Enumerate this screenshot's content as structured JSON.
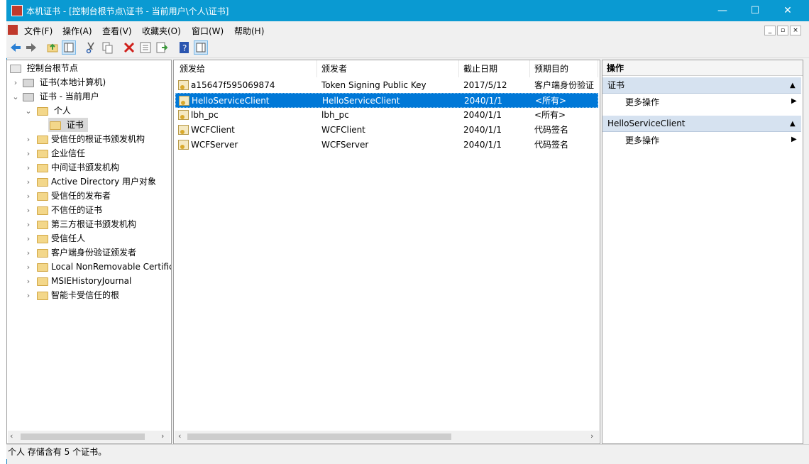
{
  "window": {
    "title": "本机证书 - [控制台根节点\\证书 - 当前用户\\个人\\证书]",
    "minimize": "—",
    "maximize": "☐",
    "close": "✕"
  },
  "menu": [
    "文件(F)",
    "操作(A)",
    "查看(V)",
    "收藏夹(O)",
    "窗口(W)",
    "帮助(H)"
  ],
  "tree": {
    "root": "控制台根节点",
    "items": [
      {
        "label": "证书(本地计算机)",
        "icon": "cert-store-icon"
      },
      {
        "label": "证书 - 当前用户",
        "icon": "cert-store-icon"
      },
      {
        "label": "个人",
        "icon": "folder-icon"
      },
      {
        "label": "证书",
        "icon": "folder-icon"
      },
      {
        "label": "受信任的根证书颁发机构",
        "icon": "folder-icon"
      },
      {
        "label": "企业信任",
        "icon": "folder-icon"
      },
      {
        "label": "中间证书颁发机构",
        "icon": "folder-icon"
      },
      {
        "label": "Active Directory 用户对象",
        "icon": "folder-icon"
      },
      {
        "label": "受信任的发布者",
        "icon": "folder-icon"
      },
      {
        "label": "不信任的证书",
        "icon": "folder-icon"
      },
      {
        "label": "第三方根证书颁发机构",
        "icon": "folder-icon"
      },
      {
        "label": "受信任人",
        "icon": "folder-icon"
      },
      {
        "label": "客户端身份验证颁发者",
        "icon": "folder-icon"
      },
      {
        "label": "Local NonRemovable Certific",
        "icon": "folder-icon"
      },
      {
        "label": "MSIEHistoryJournal",
        "icon": "folder-icon"
      },
      {
        "label": "智能卡受信任的根",
        "icon": "folder-icon"
      }
    ]
  },
  "list": {
    "columns": [
      "颁发给",
      "颁发者",
      "截止日期",
      "预期目的"
    ],
    "rows": [
      {
        "issued_to": "a15647f595069874",
        "issuer": "Token Signing Public Key",
        "expires": "2017/5/12",
        "purpose": "客户端身份验证"
      },
      {
        "issued_to": "HelloServiceClient",
        "issuer": "HelloServiceClient",
        "expires": "2040/1/1",
        "purpose": "<所有>"
      },
      {
        "issued_to": "lbh_pc",
        "issuer": "lbh_pc",
        "expires": "2040/1/1",
        "purpose": "<所有>"
      },
      {
        "issued_to": "WCFClient",
        "issuer": "WCFClient",
        "expires": "2040/1/1",
        "purpose": "代码签名"
      },
      {
        "issued_to": "WCFServer",
        "issuer": "WCFServer",
        "expires": "2040/1/1",
        "purpose": "代码签名"
      }
    ],
    "selected_index": 1
  },
  "actions": {
    "title": "操作",
    "sections": [
      {
        "header": "证书",
        "item": "更多操作"
      },
      {
        "header": "HelloServiceClient",
        "item": "更多操作"
      }
    ]
  },
  "status": "个人 存储含有 5 个证书。",
  "colors": {
    "titlebar": "#0a9ad2",
    "selection": "#0078d7",
    "action_header": "#d6e2f0"
  }
}
